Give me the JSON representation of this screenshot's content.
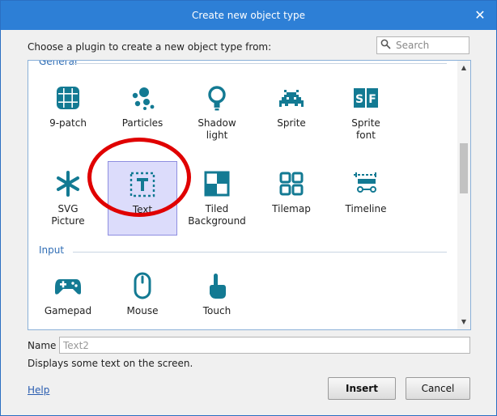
{
  "dialog": {
    "title": "Create new object type",
    "close_glyph": "✕",
    "prompt": "Choose a plugin to create a new object type from:"
  },
  "search": {
    "placeholder": "Search",
    "icon": "search-icon"
  },
  "sections": [
    {
      "label": "General",
      "items": [
        {
          "label": "9-patch",
          "icon": "nine-patch-icon"
        },
        {
          "label": "Particles",
          "icon": "particles-icon"
        },
        {
          "label": "Shadow\nlight",
          "icon": "lightbulb-icon"
        },
        {
          "label": "Sprite",
          "icon": "space-invader-icon"
        },
        {
          "label": "Sprite\nfont",
          "icon": "sprite-font-icon"
        },
        {
          "label": "SVG\nPicture",
          "icon": "asterisk-icon"
        },
        {
          "label": "Text",
          "icon": "text-box-icon",
          "selected": true
        },
        {
          "label": "Tiled\nBackground",
          "icon": "tiled-background-icon"
        },
        {
          "label": "Tilemap",
          "icon": "tilemap-icon"
        },
        {
          "label": "Timeline",
          "icon": "timeline-icon"
        }
      ]
    },
    {
      "label": "Input",
      "items": [
        {
          "label": "Gamepad",
          "icon": "gamepad-icon"
        },
        {
          "label": "Mouse",
          "icon": "mouse-icon"
        },
        {
          "label": "Touch",
          "icon": "touch-icon"
        }
      ]
    }
  ],
  "scrollbar": {
    "up_glyph": "▲",
    "down_glyph": "▼"
  },
  "name_field": {
    "label": "Name",
    "placeholder": "Text2",
    "value": ""
  },
  "description": "Displays some text on the screen.",
  "footer": {
    "help_label": "Help",
    "insert_label": "Insert",
    "cancel_label": "Cancel"
  },
  "colors": {
    "accent": "#2d7fd6",
    "icon_teal": "#137a93",
    "selection_fill": "#dcdcfb",
    "annotation_ring": "#e00000"
  }
}
